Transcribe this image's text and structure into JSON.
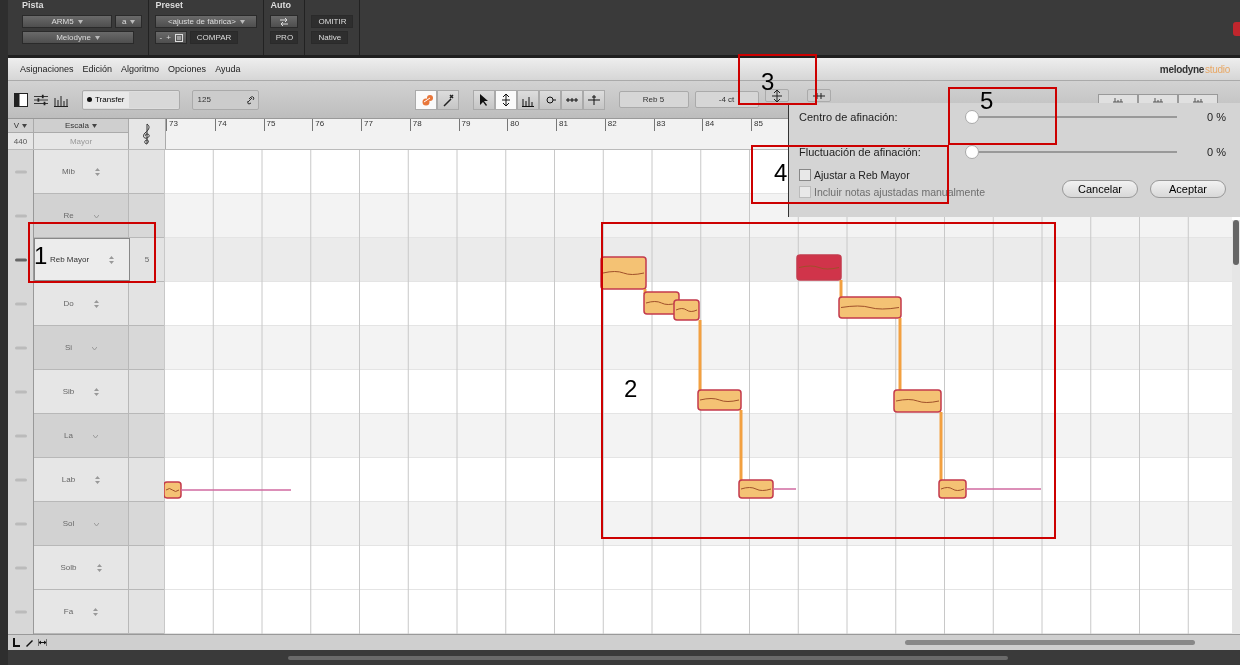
{
  "host": {
    "labels": [
      "Pista",
      "Preset",
      "Auto"
    ],
    "track_dropdowns": [
      "ARM5",
      "a"
    ],
    "plugin_dropdown": "Melodyne",
    "preset_dropdown": "<ajuste de fábrica>",
    "preset_buttons": [
      "-",
      "+"
    ],
    "compare_button": "COMPAR",
    "pro_button": "PRO",
    "omit_button": "OMITIR",
    "native_button": "Native"
  },
  "menu": [
    "Asignaciones",
    "Edición",
    "Algoritmo",
    "Opciones",
    "Ayuda"
  ],
  "logo": {
    "main": "melodyne",
    "accent": "studio"
  },
  "toolbar": {
    "transfer_button": "Transfer",
    "tempo": "125",
    "macro_tools": [
      {
        "kind": "macro",
        "selected": true
      },
      {
        "kind": "wrench",
        "selected": false
      }
    ],
    "edit_tools": [
      {
        "kind": "pointer",
        "selected": false
      },
      {
        "kind": "pitch",
        "selected": true
      },
      {
        "kind": "amplitude",
        "selected": false
      },
      {
        "kind": "formant",
        "selected": false
      },
      {
        "kind": "time",
        "selected": false
      },
      {
        "kind": "split",
        "selected": false
      }
    ],
    "pitch_field": "Reb 5",
    "cents_field": "-4 ct"
  },
  "ruler": {
    "reference_menu": "V",
    "reference_pitch": "440",
    "scale_menu": "Escala",
    "scale_name": "Mayor",
    "bars": [
      "73",
      "74",
      "75",
      "76",
      "77",
      "78",
      "79",
      "80",
      "81",
      "82",
      "83",
      "84",
      "85"
    ]
  },
  "scale_keys": [
    {
      "label": "Mib",
      "in_scale": true,
      "selected": false
    },
    {
      "label": "Re",
      "in_scale": false,
      "selected": false
    },
    {
      "label": "Reb Mayor",
      "in_scale": true,
      "selected": true,
      "count": "5"
    },
    {
      "label": "Do",
      "in_scale": true,
      "selected": false
    },
    {
      "label": "Si",
      "in_scale": false,
      "selected": false
    },
    {
      "label": "Sib",
      "in_scale": true,
      "selected": false
    },
    {
      "label": "La",
      "in_scale": false,
      "selected": false
    },
    {
      "label": "Lab",
      "in_scale": true,
      "selected": false
    },
    {
      "label": "Sol",
      "in_scale": false,
      "selected": false
    },
    {
      "label": "Solb",
      "in_scale": true,
      "selected": false
    },
    {
      "label": "Fa",
      "in_scale": true,
      "selected": false
    }
  ],
  "tuning_popup": {
    "sliders": [
      {
        "label": "Centro de afinación:",
        "level": 0,
        "reading": "0 %"
      },
      {
        "label": "Fluctuación de afinación:",
        "level": 0,
        "reading": "0 %"
      }
    ],
    "checkboxes": [
      {
        "label": "Ajustar a Reb Mayor",
        "checked": false,
        "disabled": false
      },
      {
        "label": "Incluir notas ajustadas manualmente",
        "checked": false,
        "disabled": true
      }
    ],
    "buttons": [
      "Cancelar",
      "Aceptar"
    ]
  },
  "annotations": [
    {
      "label": "1"
    },
    {
      "label": "2"
    },
    {
      "label": "3"
    },
    {
      "label": "4"
    },
    {
      "label": "5"
    }
  ]
}
